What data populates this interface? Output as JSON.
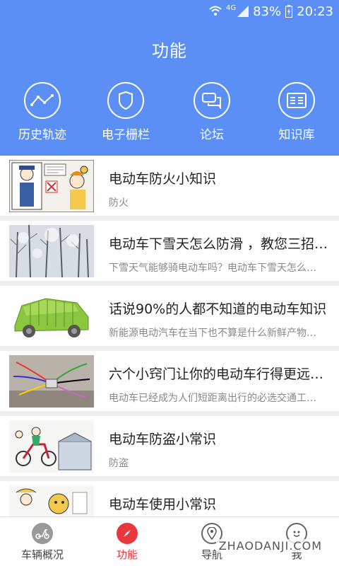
{
  "status_bar": {
    "network": "4G",
    "battery": "83%",
    "time": "20:23"
  },
  "header": {
    "title": "功能",
    "bg_color": "#5b8ff5"
  },
  "functions": [
    {
      "label": "历史轨迹",
      "icon": "track-icon"
    },
    {
      "label": "电子栅栏",
      "icon": "shield-icon"
    },
    {
      "label": "论坛",
      "icon": "chat-icon"
    },
    {
      "label": "知识库",
      "icon": "book-icon"
    }
  ],
  "articles": [
    {
      "title": "电动车防火小知识",
      "subtitle": "防火",
      "thumb": "cartoon-fire"
    },
    {
      "title": "电动车下雪天怎么防滑 ，教您三招…",
      "subtitle": "下雪天气能够骑电动车吗？电动车下雪天怎么…",
      "thumb": "snow-trees"
    },
    {
      "title": "话说90%的人都不知道的电动车知识",
      "subtitle": "新能源电动汽车在当下也不算是什么新鲜产物…",
      "thumb": "battery-car"
    },
    {
      "title": "六个小窍门让你的电动车行得更远…",
      "subtitle": "电动车已经成为人们短距离出行的必选交通工…",
      "thumb": "wires"
    },
    {
      "title": "电动车防盗小常识",
      "subtitle": "防盗",
      "thumb": "cartoon-theft"
    },
    {
      "title": "电动车使用小常识",
      "subtitle": "",
      "thumb": "cartoon-use"
    }
  ],
  "tabs": [
    {
      "label": "车辆概况",
      "icon": "scooter-icon",
      "active": false
    },
    {
      "label": "功能",
      "icon": "compass-icon",
      "active": true
    },
    {
      "label": "导航",
      "icon": "location-pin-icon",
      "active": false
    },
    {
      "label": "我",
      "icon": "smiley-icon",
      "active": false
    }
  ],
  "accent_color": "#e8383d",
  "watermark": "ZHAODANJI.COM"
}
